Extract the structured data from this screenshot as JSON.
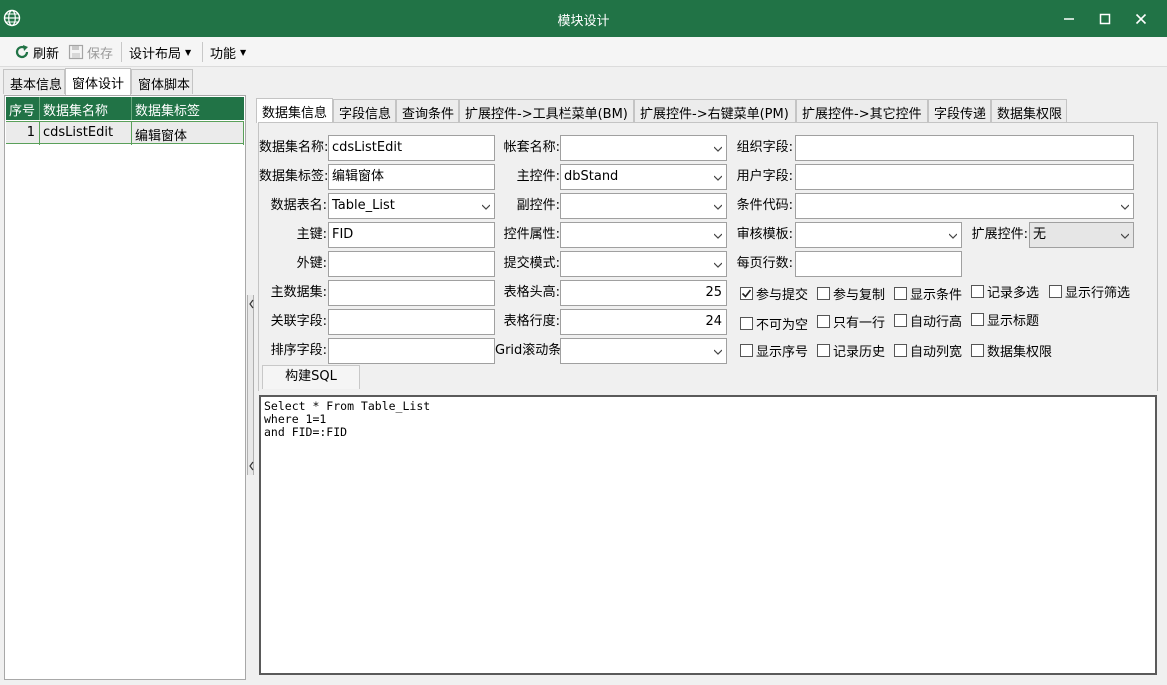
{
  "window": {
    "title": "模块设计",
    "controls": [
      "minimize",
      "maximize",
      "close"
    ]
  },
  "toolbar": {
    "refresh": "刷新",
    "save": "保存",
    "design_layout": "设计布局",
    "functions": "功能"
  },
  "main_tabs": [
    "基本信息",
    "窗体设计",
    "窗体脚本"
  ],
  "dataset_grid": {
    "columns": [
      "序号",
      "数据集名称",
      "数据集标签"
    ],
    "rows": [
      {
        "index": "1",
        "name": "cdsListEdit",
        "label": "编辑窗体"
      }
    ]
  },
  "sub_tabs": [
    "数据集信息",
    "字段信息",
    "查询条件",
    "扩展控件->工具栏菜单(BM)",
    "扩展控件->右键菜单(PM)",
    "扩展控件->其它控件",
    "字段传递",
    "数据集权限"
  ],
  "form": {
    "dataset_name_label": "数据集名称:",
    "dataset_name": "cdsListEdit",
    "dataset_tag_label": "数据集标签:",
    "dataset_tag": "编辑窗体",
    "table_name_label": "数据表名:",
    "table_name": "Table_List",
    "primary_key_label": "主键:",
    "primary_key": "FID",
    "foreign_key_label": "外键:",
    "foreign_key": "",
    "master_dataset_label": "主数据集:",
    "master_dataset": "",
    "link_field_label": "关联字段:",
    "link_field": "",
    "sort_field_label": "排序字段:",
    "sort_field": "",
    "account_name_label": "帐套名称:",
    "account_name": "",
    "main_control_label": "主控件:",
    "main_control": "dbStand",
    "sub_control_label": "副控件:",
    "sub_control": "",
    "control_props_label": "控件属性:",
    "control_props": "",
    "submit_mode_label": "提交模式:",
    "submit_mode": "",
    "header_height_label": "表格头高:",
    "header_height": "25",
    "row_height_label": "表格行度:",
    "row_height": "24",
    "grid_scroll_label": "Grid滚动条:",
    "grid_scroll": "",
    "org_field_label": "组织字段:",
    "org_field": "",
    "user_field_label": "用户字段:",
    "user_field": "",
    "condition_code_label": "条件代码:",
    "condition_code": "",
    "audit_template_label": "审核模板:",
    "audit_template": "",
    "ext_control_label": "扩展控件:",
    "ext_control": "无",
    "page_rows_label": "每页行数:",
    "page_rows": "",
    "build_sql": "构建SQL"
  },
  "checkboxes": [
    {
      "label": "参与提交",
      "checked": true
    },
    {
      "label": "参与复制",
      "checked": false
    },
    {
      "label": "显示条件",
      "checked": false
    },
    {
      "label": "记录多选",
      "checked": false
    },
    {
      "label": "显示行筛选",
      "checked": false
    },
    {
      "label": "不可为空",
      "checked": false
    },
    {
      "label": "只有一行",
      "checked": false
    },
    {
      "label": "自动行高",
      "checked": false
    },
    {
      "label": "显示标题",
      "checked": false
    },
    {
      "label": "显示序号",
      "checked": false
    },
    {
      "label": "记录历史",
      "checked": false
    },
    {
      "label": "自动列宽",
      "checked": false
    },
    {
      "label": "数据集权限",
      "checked": false
    }
  ],
  "sql_text": "Select * From Table_List\nwhere 1=1\nand FID=:FID",
  "colors": {
    "titlebar": "#217346",
    "grid_header": "#217346",
    "grid_line": "#5aa05a"
  }
}
